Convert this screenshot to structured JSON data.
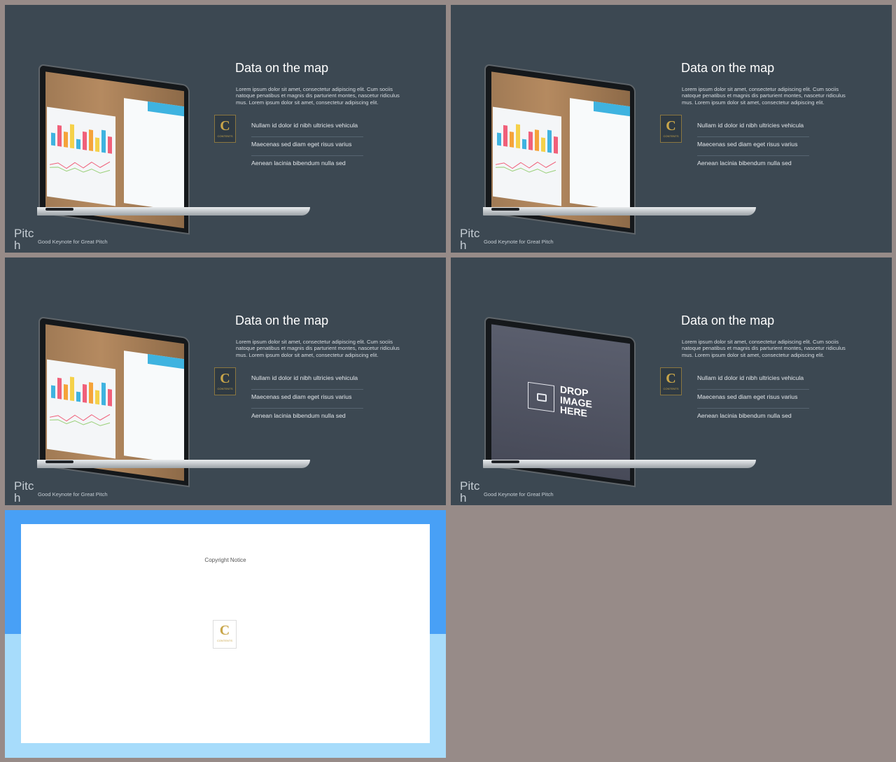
{
  "slides": [
    {
      "title": "Data on the map",
      "lorem": "Lorem ipsum dolor sit amet, consectetur adipiscing elit. Cum sociis natoque penatibus et magnis dis parturient montes, nascetur ridiculus mus. Lorem ipsum dolor sit amet, consectetur adipiscing elit.",
      "bullets": [
        "Nullam id dolor id nibh ultricies vehicula",
        "Maecenas sed diam eget risus varius",
        "Aenean lacinia bibendum nulla sed"
      ],
      "badge_letter": "C",
      "badge_text": "CONTENTS",
      "brand": "Pitch",
      "tagline": "Good Keynote for Great Pitch",
      "screen": "photo"
    },
    {
      "title": "Data on the map",
      "lorem": "Lorem ipsum dolor sit amet, consectetur adipiscing elit. Cum sociis natoque penatibus et magnis dis parturient montes, nascetur ridiculus mus. Lorem ipsum dolor sit amet, consectetur adipiscing elit.",
      "bullets": [
        "Nullam id dolor id nibh ultricies vehicula",
        "Maecenas sed diam eget risus varius",
        "Aenean lacinia bibendum nulla sed"
      ],
      "badge_letter": "C",
      "badge_text": "CONTENTS",
      "brand": "Pitch",
      "tagline": "Good Keynote for Great Pitch",
      "screen": "photo"
    },
    {
      "title": "Data on the map",
      "lorem": "Lorem ipsum dolor sit amet, consectetur adipiscing elit. Cum sociis natoque penatibus et magnis dis parturient montes, nascetur ridiculus mus. Lorem ipsum dolor sit amet, consectetur adipiscing elit.",
      "bullets": [
        "Nullam id dolor id nibh ultricies vehicula",
        "Maecenas sed diam eget risus varius",
        "Aenean lacinia bibendum nulla sed"
      ],
      "badge_letter": "C",
      "badge_text": "CONTENTS",
      "brand": "Pitch",
      "tagline": "Good Keynote for Great Pitch",
      "screen": "photo"
    },
    {
      "title": "Data on the map",
      "lorem": "Lorem ipsum dolor sit amet, consectetur adipiscing elit. Cum sociis natoque penatibus et magnis dis parturient montes, nascetur ridiculus mus. Lorem ipsum dolor sit amet, consectetur adipiscing elit.",
      "bullets": [
        "Nullam id dolor id nibh ultricies vehicula",
        "Maecenas sed diam eget risus varius",
        "Aenean lacinia bibendum nulla sed"
      ],
      "badge_letter": "C",
      "badge_text": "CONTENTS",
      "brand": "Pitch",
      "tagline": "Good Keynote for Great Pitch",
      "screen": "drop",
      "drop_lines": [
        "DROP",
        "IMAGE",
        "HERE"
      ]
    }
  ],
  "copyright": {
    "notice": "Copyright Notice",
    "logo_letter": "C",
    "logo_text": "CONTENTS"
  },
  "colors": {
    "background": "#978b88",
    "slide_bg": "#3c4852",
    "badge_gold": "#c9a64a",
    "accent_blue": "#48a0f6",
    "light_blue": "#a7dcfb"
  }
}
